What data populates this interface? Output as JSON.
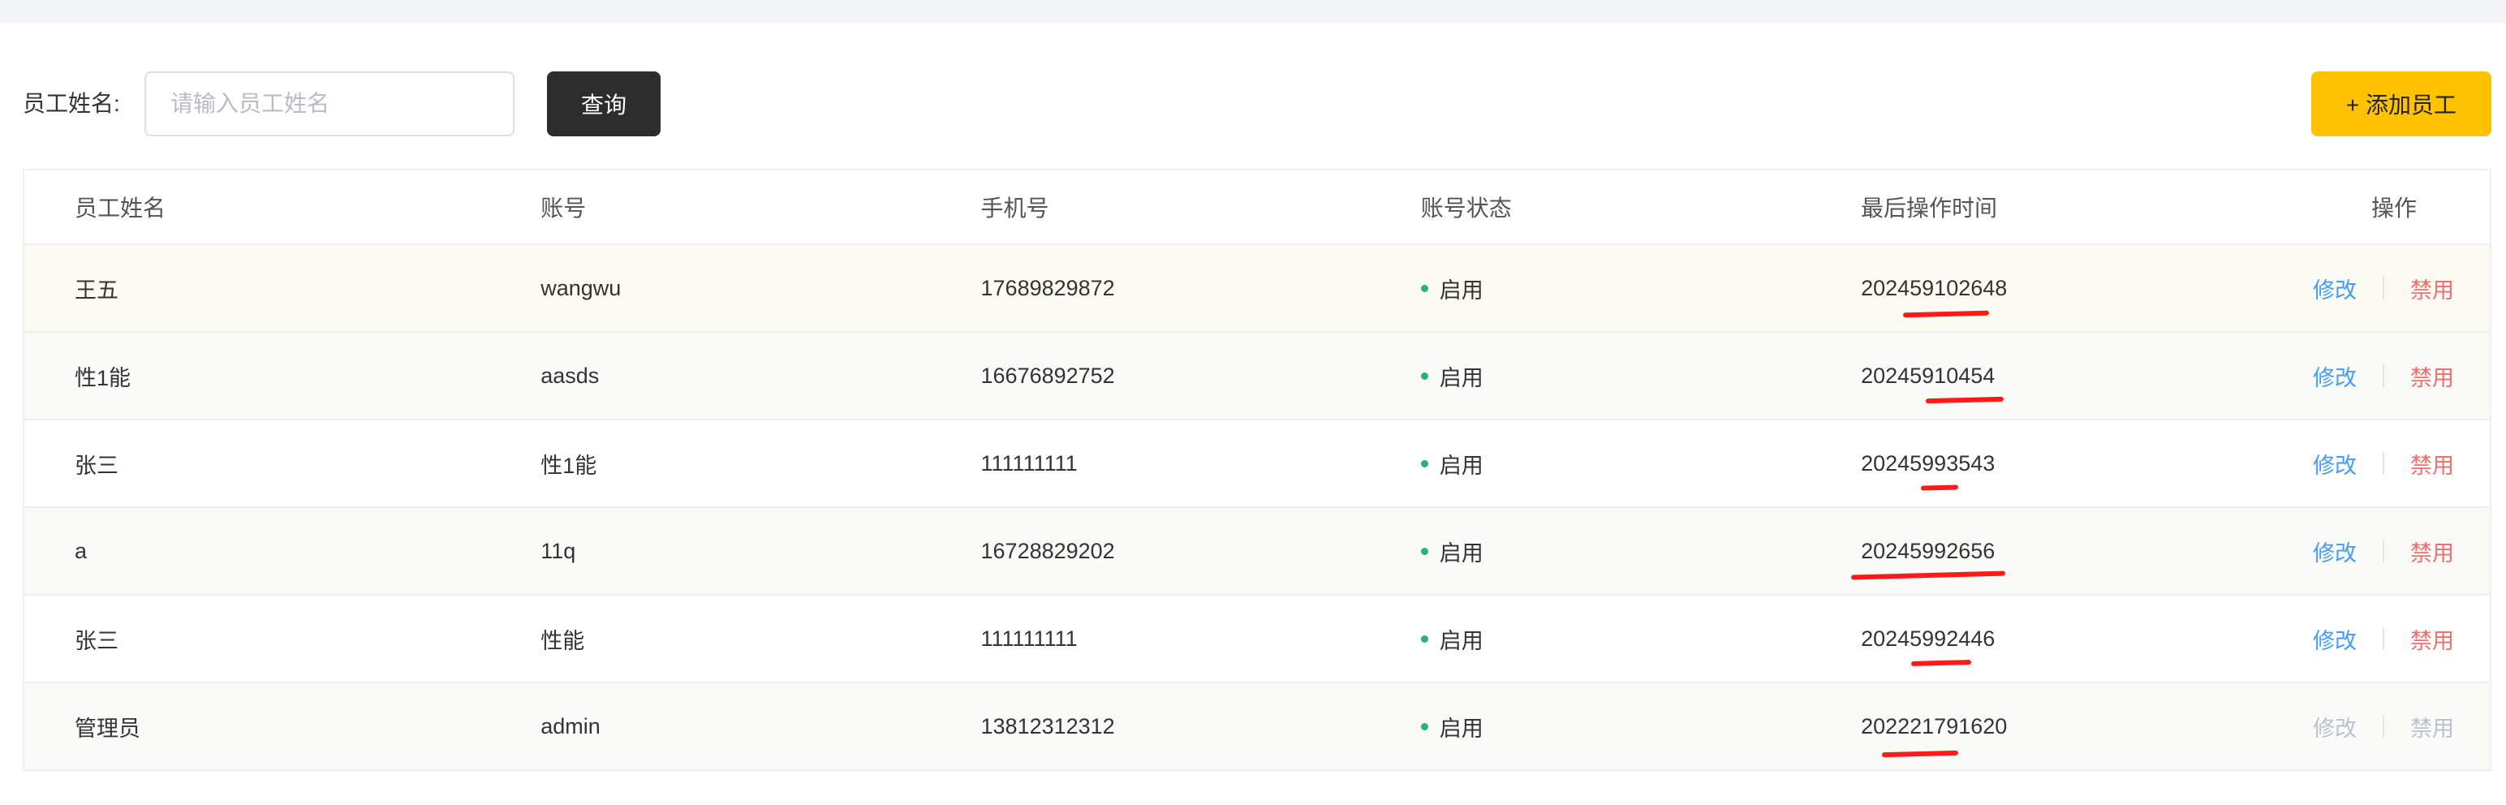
{
  "filter": {
    "label": "员工姓名:",
    "placeholder": "请输入员工姓名",
    "value": "",
    "query_button": "查询",
    "add_button": "+ 添加员工"
  },
  "table": {
    "columns": [
      "员工姓名",
      "账号",
      "手机号",
      "账号状态",
      "最后操作时间",
      "操作"
    ],
    "rows": [
      {
        "name": "王五",
        "account": "wangwu",
        "phone": "17689829872",
        "status": "启用",
        "time": "202459102648",
        "edit": "修改",
        "disable": "禁用"
      },
      {
        "name": "性1能",
        "account": "aasds",
        "phone": "16676892752",
        "status": "启用",
        "time": "20245910454",
        "edit": "修改",
        "disable": "禁用"
      },
      {
        "name": "张三",
        "account": "性1能",
        "phone": "111111111",
        "status": "启用",
        "time": "20245993543",
        "edit": "修改",
        "disable": "禁用"
      },
      {
        "name": "a",
        "account": "11q",
        "phone": "16728829202",
        "status": "启用",
        "time": "20245992656",
        "edit": "修改",
        "disable": "禁用"
      },
      {
        "name": "张三",
        "account": "性能",
        "phone": "111111111",
        "status": "启用",
        "time": "20245992446",
        "edit": "修改",
        "disable": "禁用"
      },
      {
        "name": "管理员",
        "account": "admin",
        "phone": "13812312312",
        "status": "启用",
        "time": "202221791620",
        "edit": "修改",
        "disable": "禁用"
      }
    ]
  },
  "colors": {
    "accent_add": "#ffc200",
    "query_button": "#2d2d2d",
    "status_active": "#22b573",
    "edit_link": "#419eff",
    "disable_link": "#f56c6c",
    "disabled_link": "#b8c3d1",
    "annotation": "#ff1a1a"
  }
}
